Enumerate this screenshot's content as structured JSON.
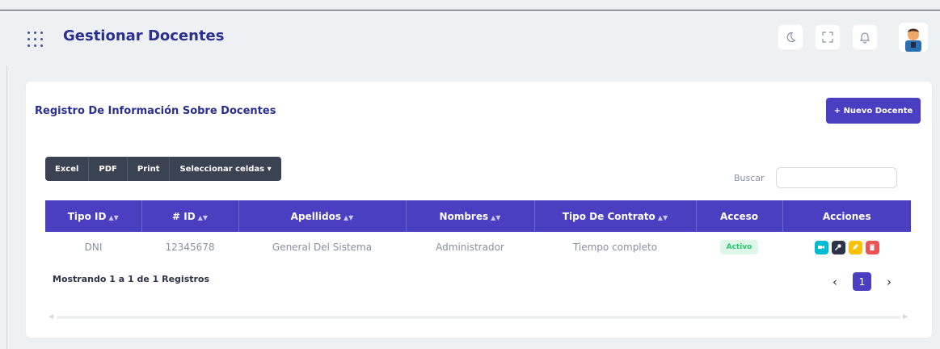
{
  "header": {
    "title": "Gestionar Docentes"
  },
  "card": {
    "title": "Registro De Información Sobre Docentes",
    "new_button": "+ Nuevo Docente"
  },
  "export": {
    "buttons": [
      "Excel",
      "PDF",
      "Print",
      "Seleccionar celdas ▾"
    ]
  },
  "search": {
    "label": "Buscar",
    "value": ""
  },
  "table": {
    "columns": [
      "Tipo ID",
      "# ID",
      "Apellidos",
      "Nombres",
      "Tipo De Contrato",
      "Acceso",
      "Acciones"
    ],
    "sortable": [
      true,
      true,
      true,
      true,
      true,
      false,
      false
    ],
    "rows": [
      {
        "tipo_id": "DNI",
        "id": "12345678",
        "apellidos": "General Del Sistema",
        "nombres": "Administrador",
        "contrato": "Tiempo completo",
        "acceso": "Activo"
      }
    ],
    "action_icons": [
      "video-icon",
      "key-icon",
      "edit-icon",
      "delete-icon"
    ]
  },
  "footer": {
    "info": "Mostrando 1 a 1 de 1 Registros",
    "prev": "‹",
    "current_page": "1",
    "next": "›"
  },
  "colors": {
    "primary": "#4a3fc1",
    "title": "#2b2f8f",
    "success": "#28c76f",
    "action_info": "#00bad1",
    "action_dark": "#2f3349",
    "action_warning": "#ffc107",
    "action_danger": "#ea5455"
  }
}
